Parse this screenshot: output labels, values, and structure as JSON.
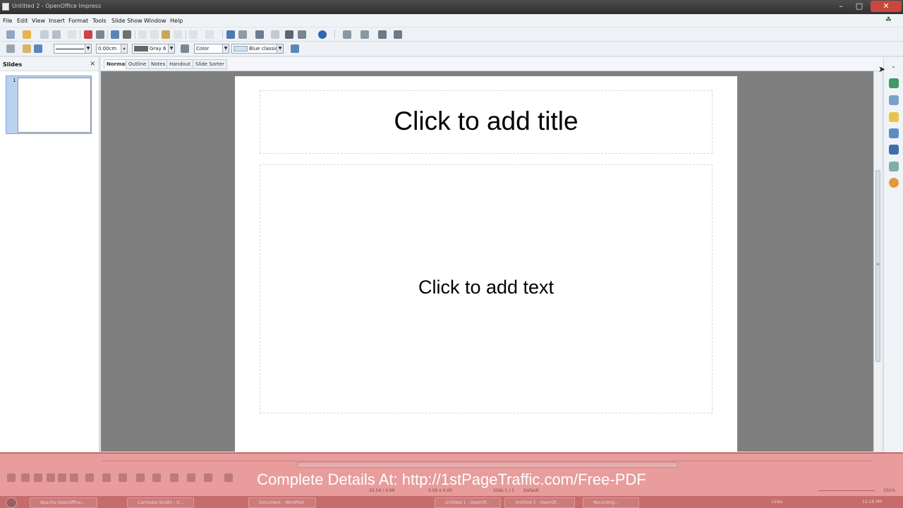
{
  "window": {
    "title": "Untitled 2 - OpenOffice Impress",
    "controls": {
      "minimize": "–",
      "maximize": "□",
      "close": "✕"
    }
  },
  "menubar": {
    "items": [
      "File",
      "Edit",
      "View",
      "Insert",
      "Format",
      "Tools",
      "Slide Show",
      "Window",
      "Help"
    ]
  },
  "line_toolbar": {
    "line_width": "0.00cm",
    "line_color": "Gray 6",
    "area_style": "Color",
    "area_fill": "Blue classic"
  },
  "slides_pane": {
    "title": "Slides",
    "close": "×",
    "slides": [
      {
        "number": "1"
      }
    ]
  },
  "view_tabs": [
    "Normal",
    "Outline",
    "Notes",
    "Handout",
    "Slide Sorter"
  ],
  "slide": {
    "title_placeholder": "Click to add title",
    "body_placeholder": "Click to add text"
  },
  "overlay": {
    "watermark": "Complete Details At: http://1stPageTraffic.com/Free-PDF"
  },
  "statusbar": {
    "position": "32.54 / 4.69",
    "size": "0.00 x 0.00",
    "slide": "Slide 1 / 1",
    "layout": "Default",
    "zoom": "101%"
  },
  "taskbar": {
    "items": [
      "Apache OpenOffice...",
      "Camtasia Studio - U...",
      "Document - WordPad",
      "Untitled 1 - OpenOf...",
      "Untitled 2 - OpenOf...",
      "Recording..."
    ],
    "links": "Links",
    "clock": "12:19 PM"
  },
  "colors": {
    "title_bar": "#3a3a3a",
    "close_button": "#c9473d",
    "canvas_background": "#7f7f7f",
    "slide_background": "#ffffff",
    "overlay_band": "#e89c9c",
    "thumbnail_selection": "#b9d2ee"
  }
}
